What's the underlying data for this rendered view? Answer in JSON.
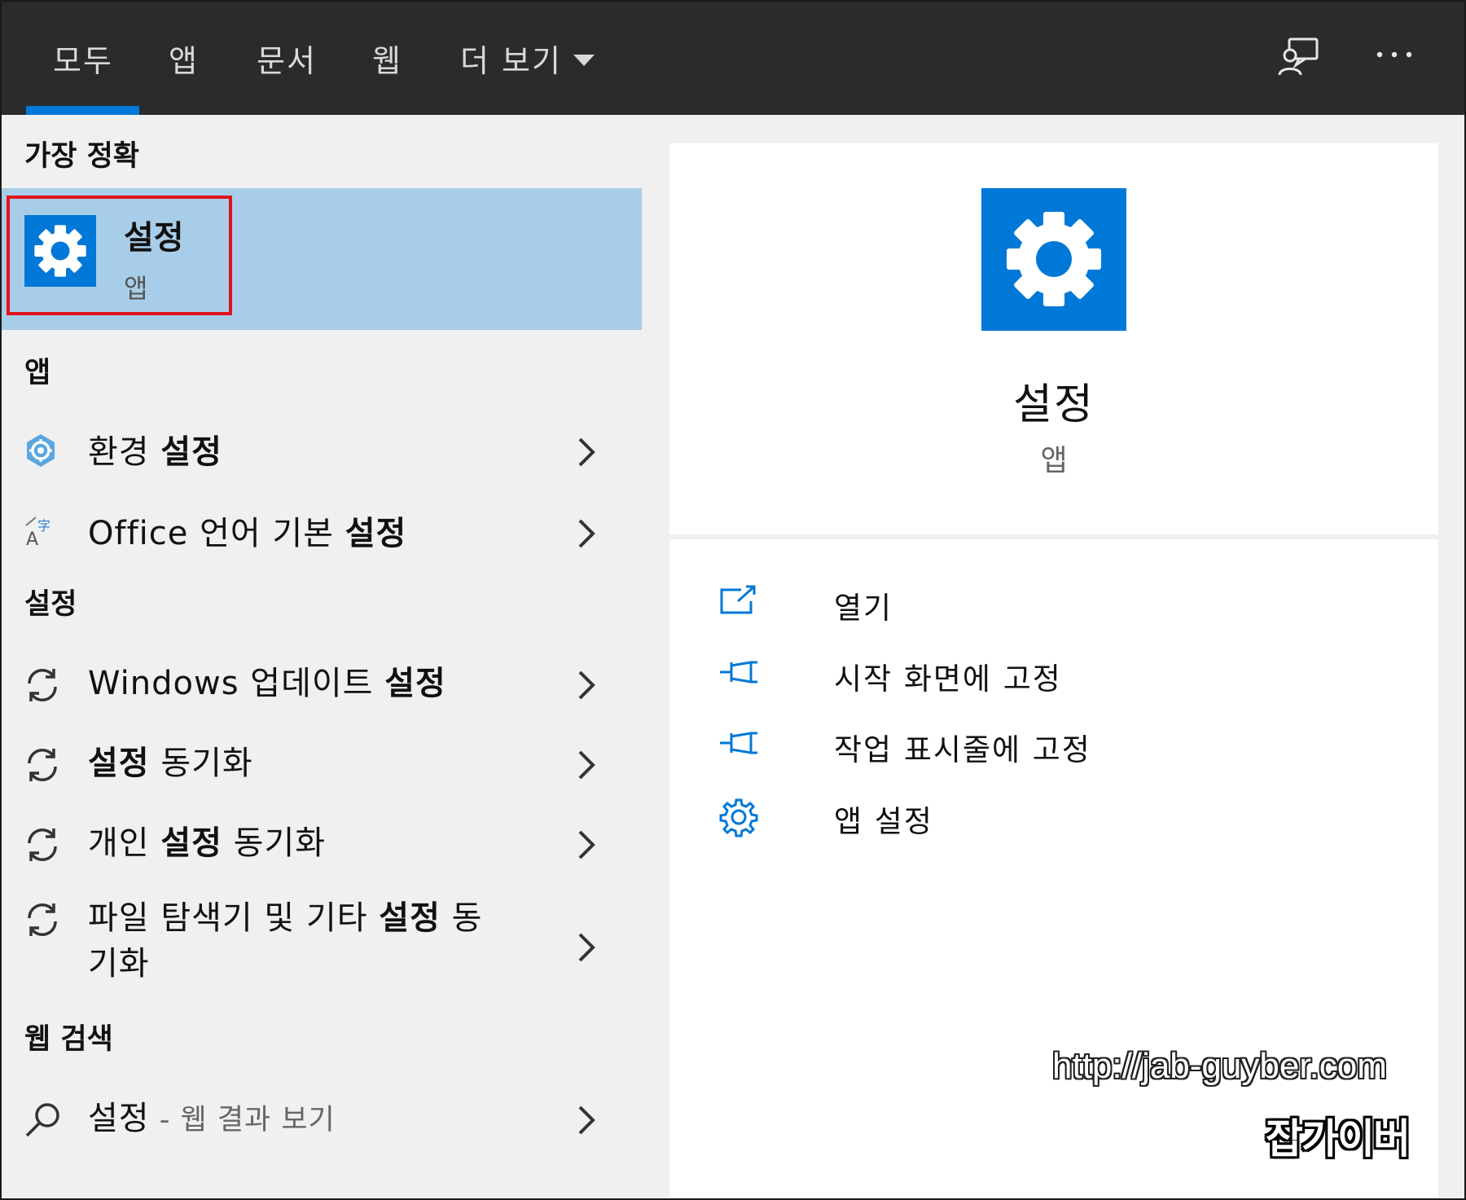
{
  "tabs": {
    "all": "모두",
    "apps": "앱",
    "documents": "문서",
    "web": "웹",
    "more": "더 보기"
  },
  "best_match": {
    "heading": "가장 정확",
    "title": "설정",
    "subtitle": "앱"
  },
  "apps_section": {
    "heading": "앱",
    "items": [
      {
        "prefix": "환경 ",
        "bold": "설정",
        "suffix": ""
      },
      {
        "prefix": "Office 언어 기본 ",
        "bold": "설정",
        "suffix": ""
      }
    ]
  },
  "settings_section": {
    "heading": "설정",
    "items": [
      {
        "prefix": "Windows 업데이트 ",
        "bold": "설정",
        "suffix": ""
      },
      {
        "prefix": "",
        "bold": "설정",
        "suffix": " 동기화"
      },
      {
        "prefix": "개인 ",
        "bold": "설정",
        "suffix": " 동기화"
      },
      {
        "prefix": "파일 탐색기 및 기타 ",
        "bold": "설정",
        "suffix": " 동",
        "line2": "기화"
      }
    ]
  },
  "web_section": {
    "heading": "웹 검색",
    "query": "설정",
    "hint": " - 웹 결과 보기"
  },
  "preview": {
    "title": "설정",
    "subtitle": "앱",
    "actions": {
      "open": "열기",
      "pin_start": "시작 화면에 고정",
      "pin_taskbar": "작업 표시줄에 고정",
      "app_settings": "앱 설정"
    }
  },
  "watermark": {
    "url": "http://jab-guyber.com",
    "name": "잡가이버"
  },
  "colors": {
    "accent": "#0078d7",
    "selection": "#a8cde8",
    "highlight_box": "#e0131b",
    "topbar": "#2b2b2b"
  }
}
